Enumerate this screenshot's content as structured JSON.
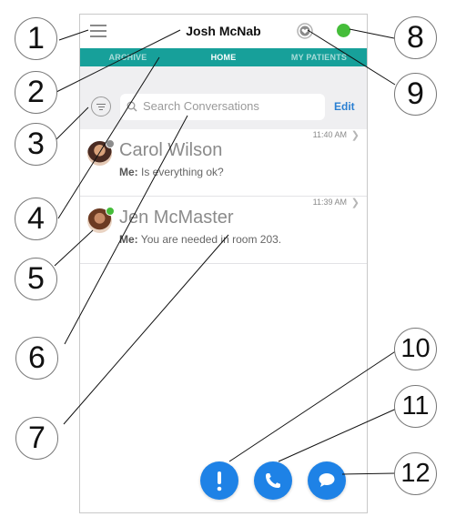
{
  "app": {
    "title": "Josh McNab",
    "status_color": "#45bd3a",
    "accent_color": "#17a09a",
    "action_color": "#1e82e6"
  },
  "header": {
    "menu_icon": "hamburger-menu-icon",
    "alert_icon": "heart-shield-toggle-icon",
    "status_icon": "availability-status-dot"
  },
  "tabs": [
    {
      "label": "ARCHIVE",
      "active": false
    },
    {
      "label": "HOME",
      "active": true
    },
    {
      "label": "MY PATIENTS",
      "active": false
    }
  ],
  "search": {
    "placeholder": "Search Conversations",
    "edit_label": "Edit",
    "filter_icon": "filter-icon",
    "search_icon": "search-icon"
  },
  "conversations": [
    {
      "name": "Carol Wilson",
      "sender": "Me:",
      "preview": "Is everything ok?",
      "time": "11:40 AM",
      "presence_color": "#8d8d8d"
    },
    {
      "name": "Jen McMaster",
      "sender": "Me:",
      "preview": "You are needed in room 203.",
      "time": "11:39 AM",
      "presence_color": "#45bd3a"
    }
  ],
  "actions": [
    {
      "icon": "alert-exclamation-icon"
    },
    {
      "icon": "phone-icon"
    },
    {
      "icon": "chat-bubble-icon"
    }
  ],
  "callouts": [
    "1",
    "2",
    "3",
    "4",
    "5",
    "6",
    "7",
    "8",
    "9",
    "10",
    "11",
    "12"
  ]
}
